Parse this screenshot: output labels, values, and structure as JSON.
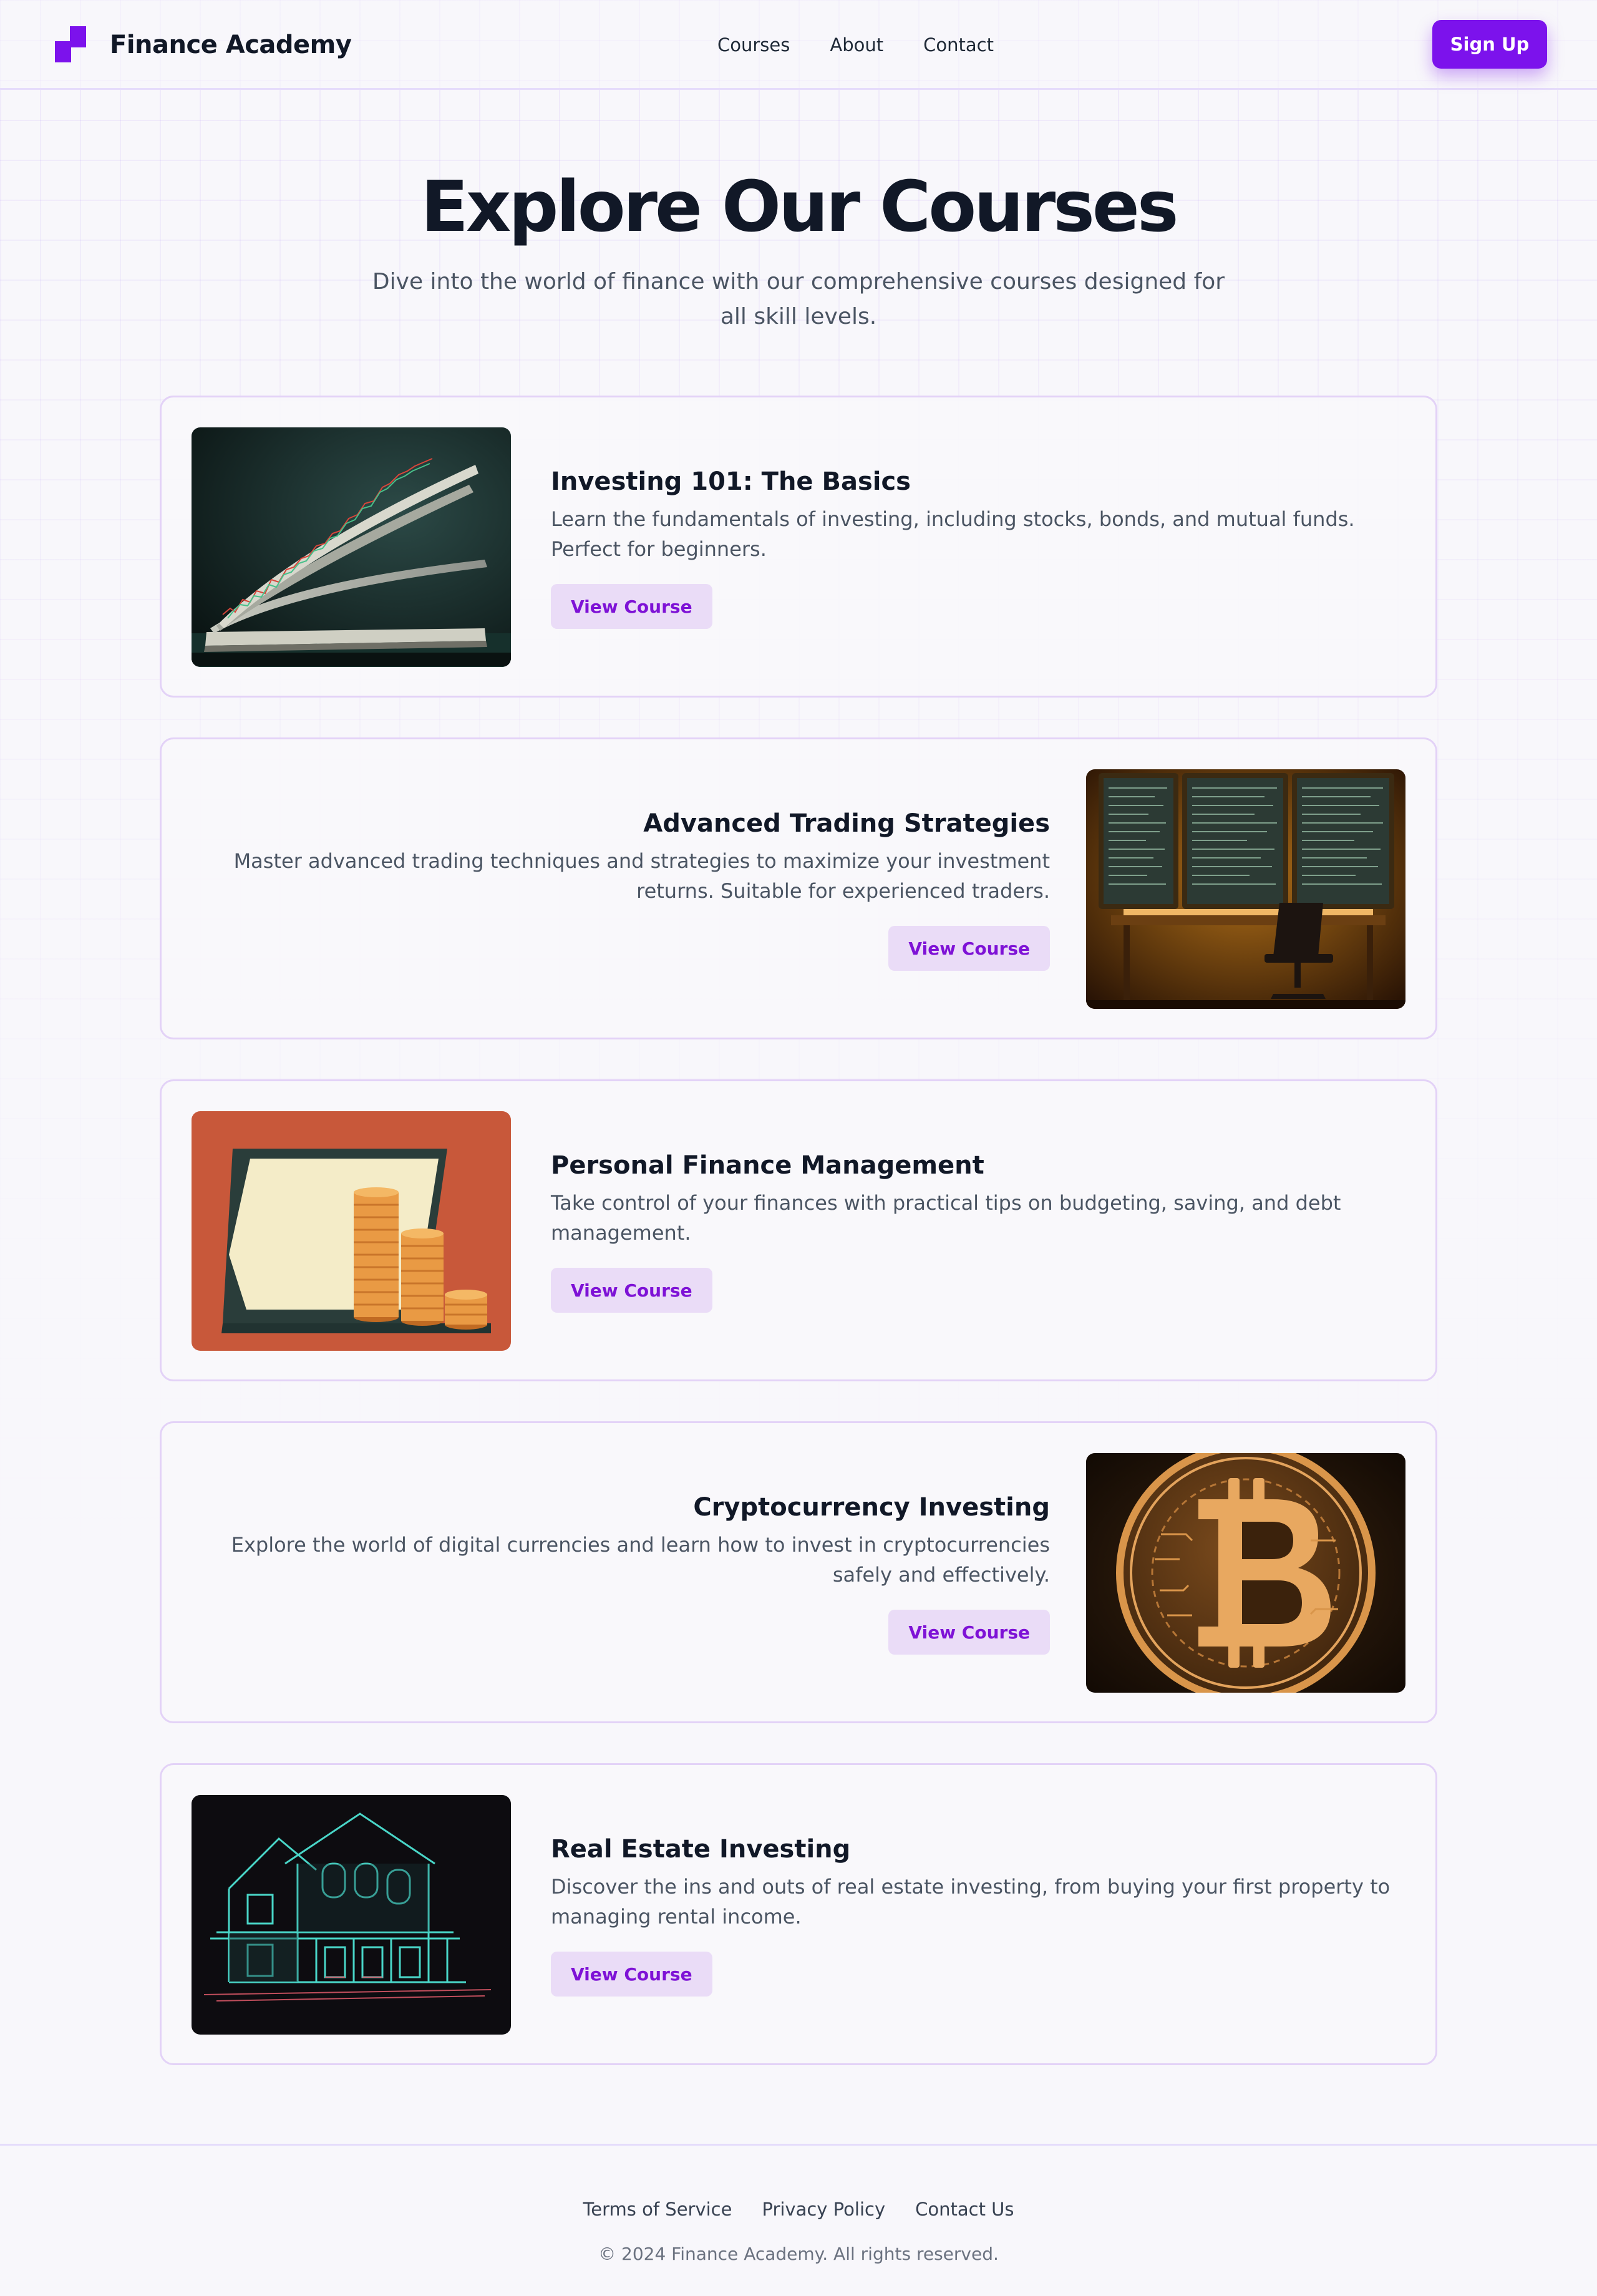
{
  "header": {
    "brand": "Finance Academy",
    "logo_icon": "finance-academy-logo",
    "nav": [
      "Courses",
      "About",
      "Contact"
    ],
    "signup_label": "Sign Up"
  },
  "hero": {
    "title": "Explore Our Courses",
    "subtitle": "Dive into the world of finance with our comprehensive courses designed for all skill levels."
  },
  "courses": [
    {
      "title": "Investing 101: The Basics",
      "description": "Learn the fundamentals of investing, including stocks, bonds, and mutual funds. Perfect for beginners.",
      "button": "View Course",
      "image": "book-with-stock-chart"
    },
    {
      "title": "Advanced Trading Strategies",
      "description": "Master advanced trading techniques and strategies to maximize your investment returns. Suitable for experienced traders.",
      "button": "View Course",
      "image": "trading-desk-monitors"
    },
    {
      "title": "Personal Finance Management",
      "description": "Take control of your finances with practical tips on budgeting, saving, and debt management.",
      "button": "View Course",
      "image": "tablet-with-coin-stacks"
    },
    {
      "title": "Cryptocurrency Investing",
      "description": "Explore the world of digital currencies and learn how to invest in cryptocurrencies safely and effectively.",
      "button": "View Course",
      "image": "bitcoin-coin"
    },
    {
      "title": "Real Estate Investing",
      "description": "Discover the ins and outs of real estate investing, from buying your first property to managing rental income.",
      "button": "View Course",
      "image": "neon-house"
    }
  ],
  "footer": {
    "links": [
      "Terms of Service",
      "Privacy Policy",
      "Contact Us"
    ],
    "copyright": "© 2024 Finance Academy. All rights reserved."
  },
  "colors": {
    "accent": "#7c12ec",
    "button_soft_bg": "#eadcf7",
    "button_soft_text": "#7e12d6",
    "card_border": "#e3d2f7",
    "page_bg": "#f8f7fb"
  }
}
